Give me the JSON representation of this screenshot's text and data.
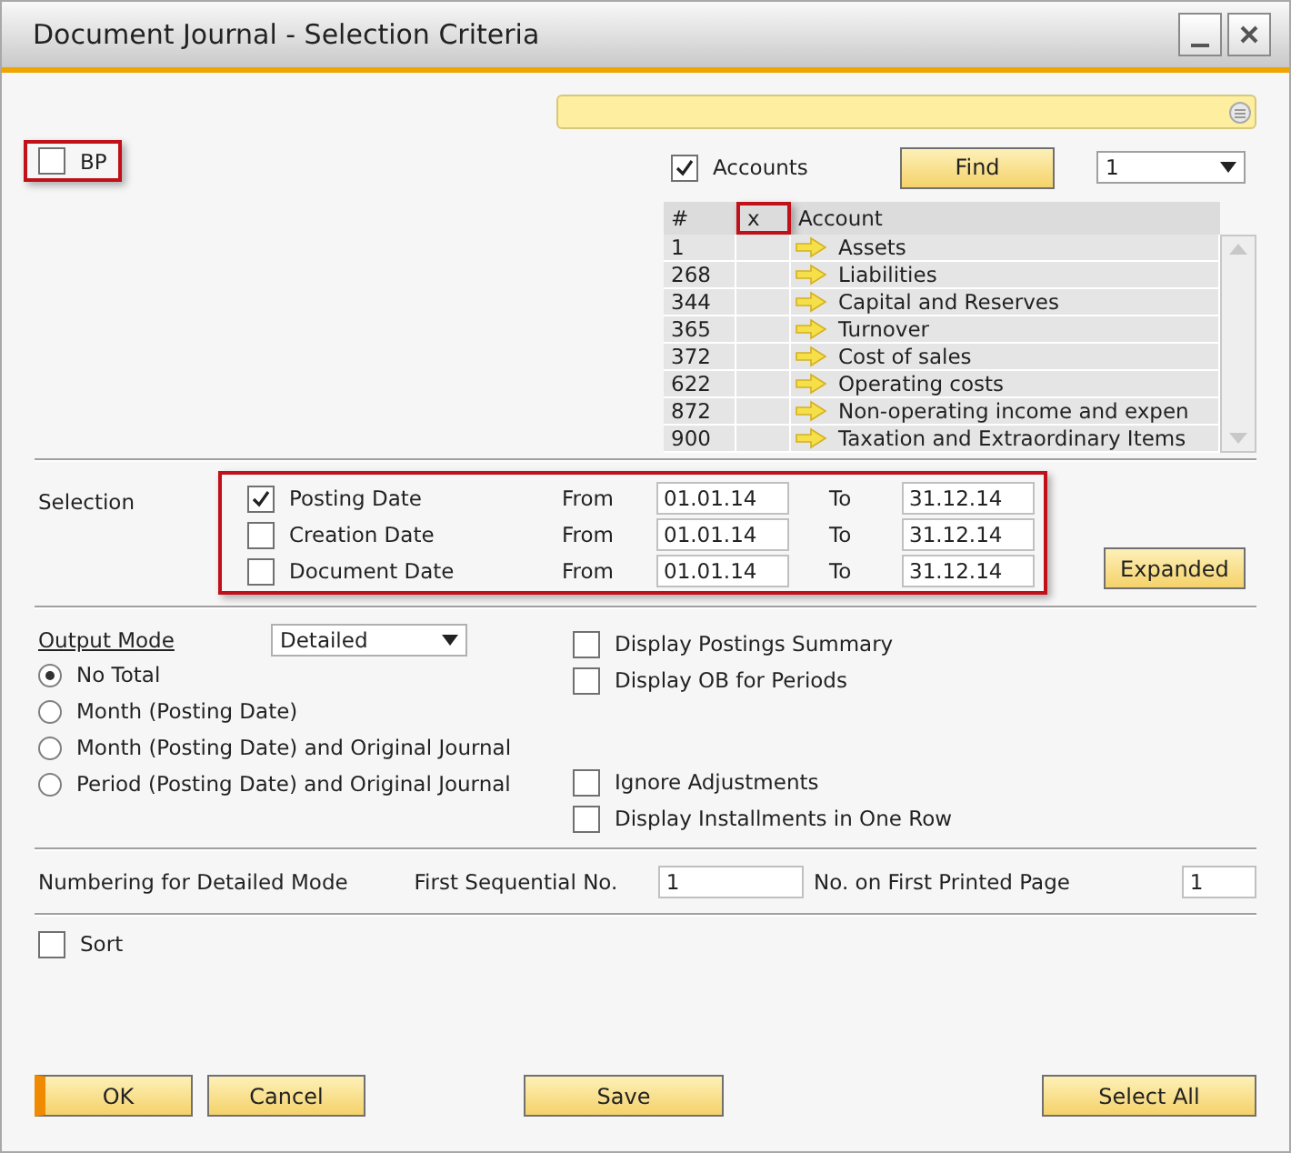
{
  "window": {
    "title": "Document Journal - Selection Criteria"
  },
  "bp": {
    "label": "BP",
    "checked": false,
    "highlighted": true
  },
  "accounts": {
    "label": "Accounts",
    "checked": true
  },
  "find_button": "Find",
  "level_dropdown": {
    "value": "1"
  },
  "table": {
    "columns": [
      {
        "label": "#",
        "highlighted": false
      },
      {
        "label": "x",
        "highlighted": true
      },
      {
        "label": "Account",
        "highlighted": false
      }
    ],
    "rows": [
      {
        "number": "1",
        "account": "Assets"
      },
      {
        "number": "268",
        "account": "Liabilities"
      },
      {
        "number": "344",
        "account": "Capital and Reserves"
      },
      {
        "number": "365",
        "account": "Turnover"
      },
      {
        "number": "372",
        "account": "Cost of sales"
      },
      {
        "number": "622",
        "account": "Operating costs"
      },
      {
        "number": "872",
        "account": "Non-operating income and expen"
      },
      {
        "number": "900",
        "account": "Taxation and Extraordinary Items"
      }
    ]
  },
  "selection": {
    "label": "Selection",
    "highlighted": true,
    "rows": [
      {
        "label": "Posting Date",
        "checked": true,
        "from_label": "From",
        "from": "01.01.14",
        "to_label": "To",
        "to": "31.12.14"
      },
      {
        "label": "Creation Date",
        "checked": false,
        "from_label": "From",
        "from": "01.01.14",
        "to_label": "To",
        "to": "31.12.14"
      },
      {
        "label": "Document Date",
        "checked": false,
        "from_label": "From",
        "from": "01.01.14",
        "to_label": "To",
        "to": "31.12.14"
      }
    ],
    "expanded_button": "Expanded"
  },
  "output": {
    "label": "Output Mode",
    "mode": "Detailed",
    "radios": [
      {
        "label": "No Total",
        "selected": true
      },
      {
        "label": "Month (Posting Date)",
        "selected": false
      },
      {
        "label": "Month (Posting Date) and Original Journal",
        "selected": false
      },
      {
        "label": "Period (Posting Date) and Original Journal",
        "selected": false
      }
    ],
    "checkboxes_top": [
      {
        "label": "Display Postings Summary",
        "checked": false
      },
      {
        "label": "Display OB for Periods",
        "checked": false
      }
    ],
    "checkboxes_bottom": [
      {
        "label": "Ignore Adjustments",
        "checked": false
      },
      {
        "label": "Display Installments in One Row",
        "checked": false
      }
    ]
  },
  "numbering": {
    "label": "Numbering for Detailed Mode",
    "first_label": "First Sequential No.",
    "first": "1",
    "page_label": "No. on First Printed Page",
    "page": "1"
  },
  "sort": {
    "label": "Sort",
    "checked": false
  },
  "buttons": [
    {
      "label": "OK",
      "default": true
    },
    {
      "label": "Cancel",
      "default": false
    },
    {
      "label": "Save",
      "default": false
    },
    {
      "label": "Select All",
      "default": false
    }
  ]
}
